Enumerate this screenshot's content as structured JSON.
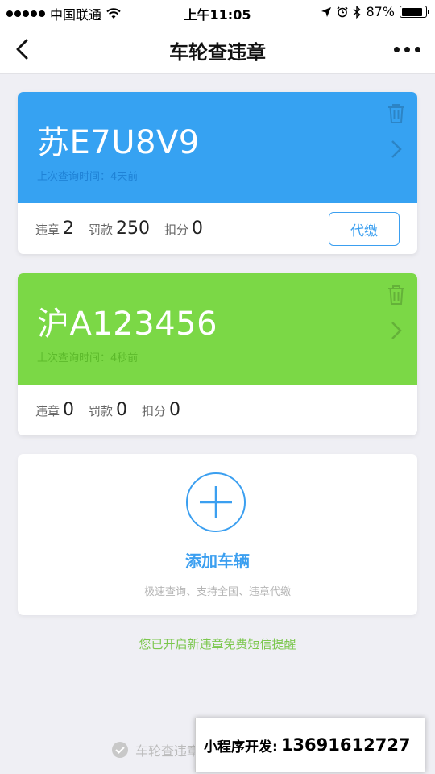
{
  "status_bar": {
    "carrier": "中国联通",
    "time": "上午11:05",
    "battery_percent": "87%",
    "battery_level": 0.87
  },
  "nav": {
    "title": "车轮查违章"
  },
  "cars": [
    {
      "plate": "苏E7U8V9",
      "last_query_label": "上次查询时间：4天前",
      "color": "#36a2f2",
      "subtext_color": "#1f82d6",
      "violations_label": "违章",
      "violations": "2",
      "fine_label": "罚款",
      "fine": "250",
      "points_label": "扣分",
      "points": "0",
      "pay_label": "代缴"
    },
    {
      "plate": "沪A123456",
      "last_query_label": "上次查询时间：4秒前",
      "color": "#7bd846",
      "subtext_color": "#5cba2b",
      "violations_label": "违章",
      "violations": "0",
      "fine_label": "罚款",
      "fine": "0",
      "points_label": "扣分",
      "points": "0"
    }
  ],
  "add_card": {
    "title": "添加车辆",
    "subtitle": "极速查询、支持全国、违章代缴"
  },
  "sms_notice": "您已开启新违章免费短信提醒",
  "footer": {
    "brand": "车轮查违章"
  },
  "dev_banner": {
    "label": "小程序开发:",
    "phone": "13691612727"
  },
  "colors": {
    "accent": "#3b9ff0",
    "green_notice": "#7bc74d",
    "background": "#efeff4"
  },
  "icons": [
    "back-icon",
    "more-icon",
    "trash-icon",
    "chevron-right-icon",
    "add-icon",
    "check-icon",
    "wifi-icon",
    "location-icon",
    "alarm-icon",
    "bluetooth-icon",
    "battery-icon"
  ]
}
